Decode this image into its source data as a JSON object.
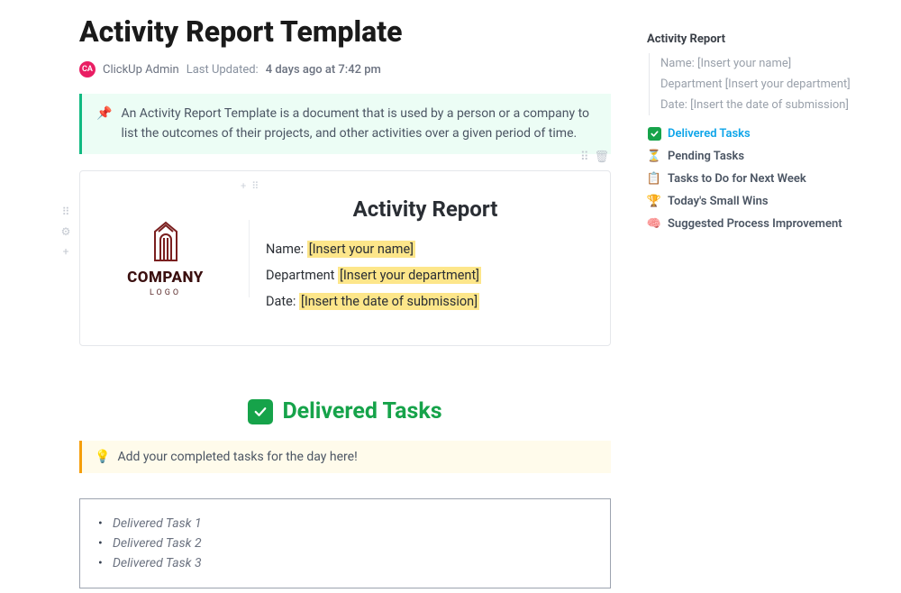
{
  "page": {
    "title": "Activity Report Template",
    "author_initials": "CA",
    "author": "ClickUp Admin",
    "updated_label": "Last Updated:",
    "updated_value": "4 days ago at 7:42 pm"
  },
  "callout": {
    "icon": "📌",
    "text": "An Activity Report Template is a document that is used by a person or a company to list the outcomes of their projects, and other activities over a given period of time."
  },
  "card": {
    "logo_text": "COMPANY",
    "logo_sub": "LOGO",
    "title": "Activity Report",
    "fields": {
      "name_label": "Name:",
      "name_ph": "[Insert your name]",
      "dept_label": "Department",
      "dept_ph": "[Insert your department]",
      "date_label": "Date:",
      "date_ph": "[Insert the date of submission]"
    }
  },
  "sections": {
    "delivered": {
      "title": "Delivered Tasks",
      "tip_icon": "💡",
      "tip": "Add your completed tasks for the day here!",
      "items": [
        "Delivered Task 1",
        "Delivered Task 2",
        "Delivered Task 3"
      ]
    }
  },
  "outline": {
    "header": "Activity Report",
    "subs": [
      "Name: [Insert your name]",
      "Department [Insert your department]",
      "Date: [Insert the date of submission]"
    ],
    "items": [
      {
        "icon": "check",
        "label": "Delivered Tasks",
        "active": true
      },
      {
        "icon": "⏳",
        "label": "Pending Tasks"
      },
      {
        "icon": "📋",
        "label": "Tasks to Do for Next Week"
      },
      {
        "icon": "🏆",
        "label": "Today's Small Wins"
      },
      {
        "icon": "🧠",
        "label": "Suggested Process Improvement"
      }
    ]
  }
}
